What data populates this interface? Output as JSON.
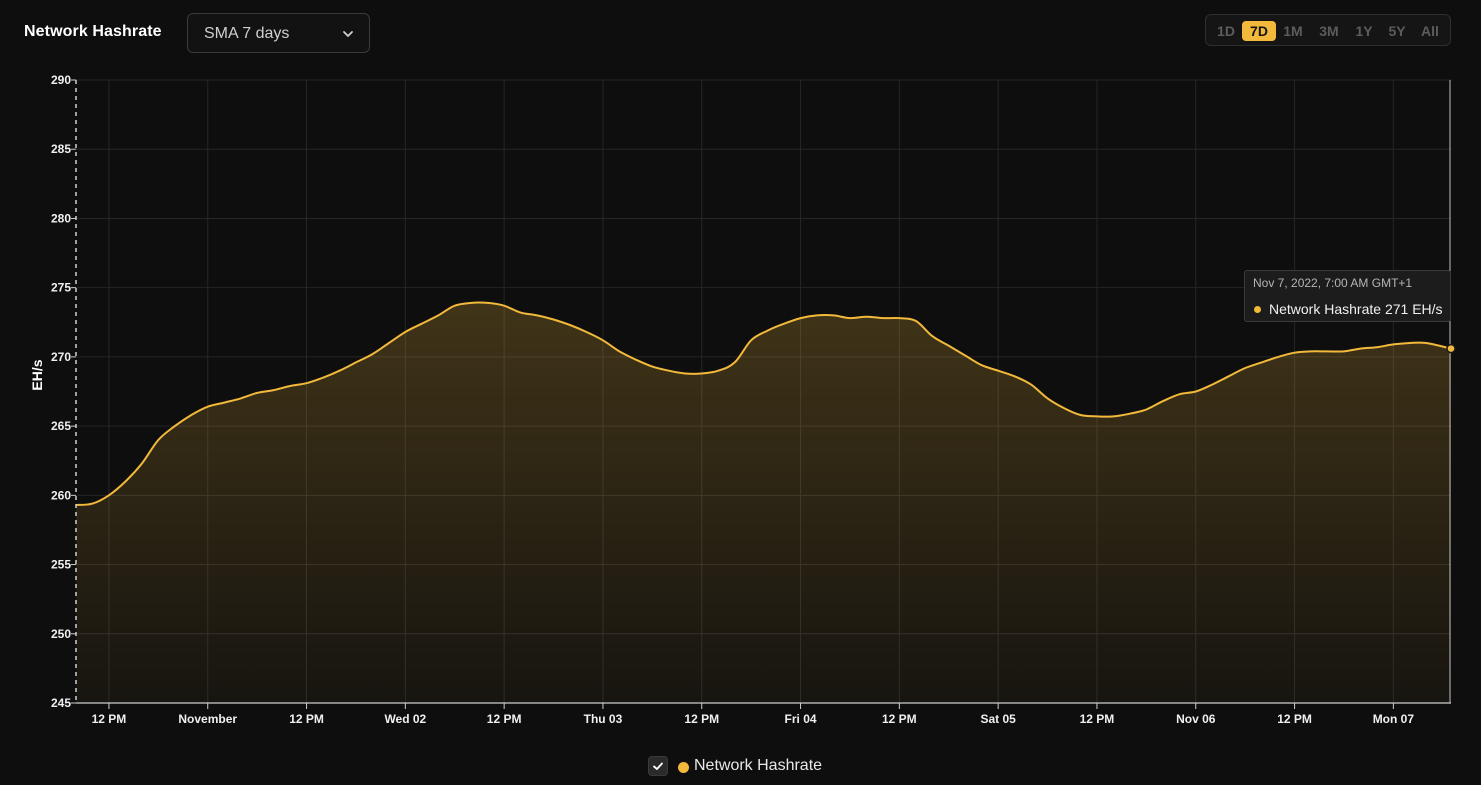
{
  "header": {
    "title": "Network Hashrate",
    "select_value": "SMA 7 days",
    "ranges": [
      {
        "label": "1D",
        "active": false
      },
      {
        "label": "7D",
        "active": true
      },
      {
        "label": "1M",
        "active": false
      },
      {
        "label": "3M",
        "active": false
      },
      {
        "label": "1Y",
        "active": false
      },
      {
        "label": "5Y",
        "active": false
      },
      {
        "label": "All",
        "active": false
      }
    ]
  },
  "tooltip": {
    "date": "Nov 7, 2022, 7:00 AM GMT+1",
    "series": "Network Hashrate",
    "value": "271",
    "unit": "EH/s"
  },
  "legend": {
    "label": "Network Hashrate"
  },
  "colors": {
    "accent": "#f2b93b",
    "background": "#0e0e0e",
    "grid": "#262626"
  },
  "chart_data": {
    "type": "area",
    "ylabel": "EH/s",
    "ylim": [
      245,
      290
    ],
    "yticks": [
      245,
      250,
      255,
      260,
      265,
      270,
      275,
      280,
      285,
      290
    ],
    "xlim": [
      0,
      167
    ],
    "xticks": [
      {
        "x": 4,
        "label": "12 PM"
      },
      {
        "x": 16,
        "label": "November"
      },
      {
        "x": 28,
        "label": "12 PM"
      },
      {
        "x": 40,
        "label": "Wed 02"
      },
      {
        "x": 52,
        "label": "12 PM"
      },
      {
        "x": 64,
        "label": "Thu 03"
      },
      {
        "x": 76,
        "label": "12 PM"
      },
      {
        "x": 88,
        "label": "Fri 04"
      },
      {
        "x": 100,
        "label": "12 PM"
      },
      {
        "x": 112,
        "label": "Sat 05"
      },
      {
        "x": 124,
        "label": "12 PM"
      },
      {
        "x": 136,
        "label": "Nov 06"
      },
      {
        "x": 148,
        "label": "12 PM"
      },
      {
        "x": 160,
        "label": "Mon 07"
      }
    ],
    "grid": true,
    "legend_position": "bottom-center",
    "series": [
      {
        "name": "Network Hashrate",
        "points": [
          [
            0,
            259.3
          ],
          [
            2,
            259.4
          ],
          [
            4,
            260.0
          ],
          [
            6,
            261.0
          ],
          [
            8,
            262.3
          ],
          [
            10,
            264.0
          ],
          [
            12,
            265.0
          ],
          [
            14,
            265.8
          ],
          [
            16,
            266.4
          ],
          [
            18,
            266.7
          ],
          [
            20,
            267.0
          ],
          [
            22,
            267.4
          ],
          [
            24,
            267.6
          ],
          [
            26,
            267.9
          ],
          [
            28,
            268.1
          ],
          [
            30,
            268.5
          ],
          [
            32,
            269.0
          ],
          [
            34,
            269.6
          ],
          [
            36,
            270.2
          ],
          [
            38,
            271.0
          ],
          [
            40,
            271.8
          ],
          [
            42,
            272.4
          ],
          [
            44,
            273.0
          ],
          [
            46,
            273.7
          ],
          [
            48,
            273.9
          ],
          [
            50,
            273.9
          ],
          [
            52,
            273.7
          ],
          [
            54,
            273.2
          ],
          [
            56,
            273.0
          ],
          [
            58,
            272.7
          ],
          [
            60,
            272.3
          ],
          [
            62,
            271.8
          ],
          [
            64,
            271.2
          ],
          [
            66,
            270.4
          ],
          [
            68,
            269.8
          ],
          [
            70,
            269.3
          ],
          [
            72,
            269.0
          ],
          [
            74,
            268.8
          ],
          [
            76,
            268.8
          ],
          [
            78,
            269.0
          ],
          [
            80,
            269.6
          ],
          [
            82,
            271.2
          ],
          [
            84,
            271.9
          ],
          [
            86,
            272.4
          ],
          [
            88,
            272.8
          ],
          [
            90,
            273.0
          ],
          [
            92,
            273.0
          ],
          [
            94,
            272.8
          ],
          [
            96,
            272.9
          ],
          [
            98,
            272.8
          ],
          [
            100,
            272.8
          ],
          [
            102,
            272.6
          ],
          [
            104,
            271.5
          ],
          [
            106,
            270.8
          ],
          [
            108,
            270.1
          ],
          [
            110,
            269.4
          ],
          [
            112,
            269.0
          ],
          [
            114,
            268.6
          ],
          [
            116,
            268.0
          ],
          [
            118,
            267.0
          ],
          [
            120,
            266.3
          ],
          [
            122,
            265.8
          ],
          [
            124,
            265.7
          ],
          [
            126,
            265.7
          ],
          [
            128,
            265.9
          ],
          [
            130,
            266.2
          ],
          [
            132,
            266.8
          ],
          [
            134,
            267.3
          ],
          [
            136,
            267.5
          ],
          [
            138,
            268.0
          ],
          [
            140,
            268.6
          ],
          [
            142,
            269.2
          ],
          [
            144,
            269.6
          ],
          [
            146,
            270.0
          ],
          [
            148,
            270.3
          ],
          [
            150,
            270.4
          ],
          [
            152,
            270.4
          ],
          [
            154,
            270.4
          ],
          [
            156,
            270.6
          ],
          [
            158,
            270.7
          ],
          [
            160,
            270.9
          ],
          [
            162,
            271.0
          ],
          [
            164,
            271.0
          ],
          [
            167,
            270.6
          ]
        ]
      }
    ]
  }
}
